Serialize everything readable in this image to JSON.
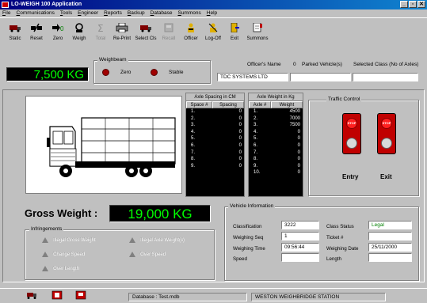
{
  "window": {
    "title": "LO-WEIGH 100 Application",
    "controls": [
      "_",
      "▫",
      "✕"
    ]
  },
  "menu": [
    "File",
    "Communications",
    "Tools",
    "Engineer",
    "Reports",
    "Backup",
    "Database",
    "Summons",
    "Help"
  ],
  "toolbar": [
    {
      "label": "Static",
      "icon": "truck-icon"
    },
    {
      "label": "Reset",
      "icon": "reset-icon"
    },
    {
      "label": "Zero",
      "icon": "zero-arrow-icon"
    },
    {
      "label": "Weigh",
      "icon": "weigh-icon"
    },
    {
      "label": "Total",
      "icon": "total-sigma-icon",
      "disabled": true
    },
    {
      "label": "Re-Print",
      "icon": "printer-icon"
    },
    {
      "label": "Select Cls",
      "icon": "truck-select-icon"
    },
    {
      "label": "Recall",
      "icon": "recall-icon",
      "disabled": true
    },
    {
      "label": "Officer",
      "icon": "officer-icon"
    },
    {
      "label": "Log-Off",
      "icon": "logoff-icon"
    },
    {
      "label": "Exit",
      "icon": "exit-door-icon"
    },
    {
      "label": "Summons",
      "icon": "summons-icon"
    }
  ],
  "weighbeam": {
    "label": "Weighbeam",
    "reading": "7,500 KG",
    "zero_label": "Zero",
    "stable_label": "Stable"
  },
  "officer": {
    "label": "Officer's Name",
    "value": "TDC SYSTEMS LTD"
  },
  "parked": {
    "count": "0",
    "label": "Parked Vehicle(s)"
  },
  "selected_class": {
    "label": "Selected Class (No of Axles)",
    "value": ""
  },
  "axle_spacing": {
    "title": "Axle Spacing in CM",
    "columns": [
      "Space #",
      "Spacing"
    ],
    "rows": [
      [
        "1.",
        "0"
      ],
      [
        "2.",
        "0"
      ],
      [
        "3.",
        "0"
      ],
      [
        "4.",
        "0"
      ],
      [
        "5.",
        "0"
      ],
      [
        "6.",
        "0"
      ],
      [
        "7.",
        "0"
      ],
      [
        "8.",
        "0"
      ],
      [
        "9.",
        "0"
      ]
    ]
  },
  "axle_weight": {
    "title": "Axle Weight in Kg",
    "columns": [
      "Axle #",
      "Weight"
    ],
    "rows": [
      [
        "1.",
        "4500"
      ],
      [
        "2.",
        "7000"
      ],
      [
        "3.",
        "7500"
      ],
      [
        "4.",
        "0"
      ],
      [
        "5.",
        "0"
      ],
      [
        "6.",
        "0"
      ],
      [
        "7.",
        "0"
      ],
      [
        "8.",
        "0"
      ],
      [
        "9.",
        "0"
      ],
      [
        "10.",
        "0"
      ]
    ]
  },
  "traffic_control": {
    "label": "Traffic Control",
    "entry_label": "Entry",
    "exit_label": "Exit",
    "stop_text": "STOP"
  },
  "gross": {
    "label": "Gross Weight :",
    "value": "19,000 KG"
  },
  "infringements": {
    "label": "Infringements",
    "items": [
      "Illegal Gross Weight",
      "Illegal Axle Weight(s)",
      "Change Speed",
      "Over Speed",
      "Over Length"
    ]
  },
  "vehicle_info": {
    "label": "Vehicle Information",
    "classification_label": "Classification",
    "classification": "3222",
    "weighing_seq_label": "Weighing Seq",
    "weighing_seq": "1",
    "weighing_time_label": "Weighing Time",
    "weighing_time": "09:56:44",
    "speed_label": "Speed",
    "speed": "",
    "class_status_label": "Class Status",
    "class_status": "Legal",
    "ticket_label": "Ticket #",
    "ticket": "",
    "weighing_date_label": "Weighing Date",
    "weighing_date": "25/11/2000",
    "length_label": "Length",
    "length": ""
  },
  "status": {
    "database": "Database : Test.mdb",
    "station": "WESTON WEIGHBRIDGE STATION"
  },
  "colors": {
    "lcd_text": "#00ff00",
    "lcd_bg": "#000000",
    "legal": "#008000",
    "title_bar": "#000080"
  }
}
